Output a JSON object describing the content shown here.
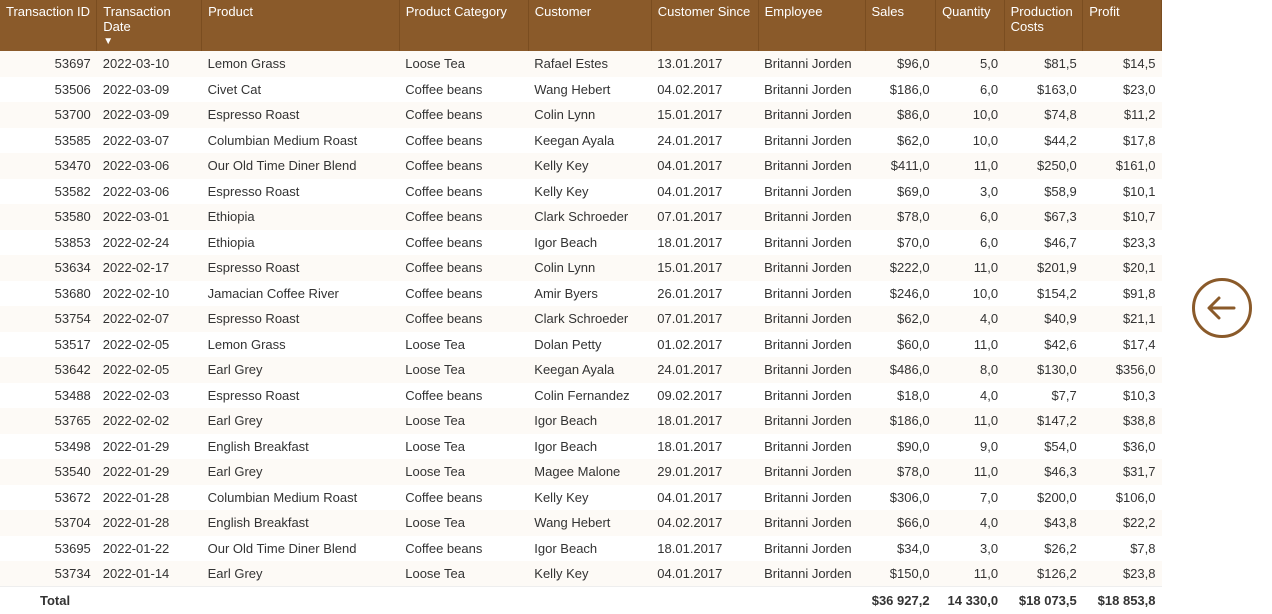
{
  "columns": [
    {
      "label": "Transaction ID",
      "key": "tid",
      "num": true
    },
    {
      "label": "Transaction Date",
      "key": "date",
      "num": false,
      "sort": "desc"
    },
    {
      "label": "Product",
      "key": "product",
      "num": false
    },
    {
      "label": "Product Category",
      "key": "category",
      "num": false
    },
    {
      "label": "Customer",
      "key": "customer",
      "num": false
    },
    {
      "label": "Customer Since",
      "key": "since",
      "num": false
    },
    {
      "label": "Employee",
      "key": "employee",
      "num": false
    },
    {
      "label": "Sales",
      "key": "sales",
      "num": true
    },
    {
      "label": "Quantity",
      "key": "qty",
      "num": true
    },
    {
      "label": "Production Costs",
      "key": "pc",
      "num": true
    },
    {
      "label": "Profit",
      "key": "profit",
      "num": true
    }
  ],
  "rows": [
    {
      "tid": "53697",
      "date": "2022-03-10",
      "product": "Lemon Grass",
      "category": "Loose Tea",
      "customer": "Rafael Estes",
      "since": "13.01.2017",
      "employee": "Britanni Jorden",
      "sales": "$96,0",
      "qty": "5,0",
      "pc": "$81,5",
      "profit": "$14,5"
    },
    {
      "tid": "53506",
      "date": "2022-03-09",
      "product": "Civet Cat",
      "category": "Coffee beans",
      "customer": "Wang Hebert",
      "since": "04.02.2017",
      "employee": "Britanni Jorden",
      "sales": "$186,0",
      "qty": "6,0",
      "pc": "$163,0",
      "profit": "$23,0"
    },
    {
      "tid": "53700",
      "date": "2022-03-09",
      "product": "Espresso Roast",
      "category": "Coffee beans",
      "customer": "Colin Lynn",
      "since": "15.01.2017",
      "employee": "Britanni Jorden",
      "sales": "$86,0",
      "qty": "10,0",
      "pc": "$74,8",
      "profit": "$11,2"
    },
    {
      "tid": "53585",
      "date": "2022-03-07",
      "product": "Columbian Medium Roast",
      "category": "Coffee beans",
      "customer": "Keegan Ayala",
      "since": "24.01.2017",
      "employee": "Britanni Jorden",
      "sales": "$62,0",
      "qty": "10,0",
      "pc": "$44,2",
      "profit": "$17,8"
    },
    {
      "tid": "53470",
      "date": "2022-03-06",
      "product": "Our Old Time Diner Blend",
      "category": "Coffee beans",
      "customer": "Kelly Key",
      "since": "04.01.2017",
      "employee": "Britanni Jorden",
      "sales": "$411,0",
      "qty": "11,0",
      "pc": "$250,0",
      "profit": "$161,0"
    },
    {
      "tid": "53582",
      "date": "2022-03-06",
      "product": "Espresso Roast",
      "category": "Coffee beans",
      "customer": "Kelly Key",
      "since": "04.01.2017",
      "employee": "Britanni Jorden",
      "sales": "$69,0",
      "qty": "3,0",
      "pc": "$58,9",
      "profit": "$10,1"
    },
    {
      "tid": "53580",
      "date": "2022-03-01",
      "product": "Ethiopia",
      "category": "Coffee beans",
      "customer": "Clark Schroeder",
      "since": "07.01.2017",
      "employee": "Britanni Jorden",
      "sales": "$78,0",
      "qty": "6,0",
      "pc": "$67,3",
      "profit": "$10,7"
    },
    {
      "tid": "53853",
      "date": "2022-02-24",
      "product": "Ethiopia",
      "category": "Coffee beans",
      "customer": "Igor Beach",
      "since": "18.01.2017",
      "employee": "Britanni Jorden",
      "sales": "$70,0",
      "qty": "6,0",
      "pc": "$46,7",
      "profit": "$23,3"
    },
    {
      "tid": "53634",
      "date": "2022-02-17",
      "product": "Espresso Roast",
      "category": "Coffee beans",
      "customer": "Colin Lynn",
      "since": "15.01.2017",
      "employee": "Britanni Jorden",
      "sales": "$222,0",
      "qty": "11,0",
      "pc": "$201,9",
      "profit": "$20,1"
    },
    {
      "tid": "53680",
      "date": "2022-02-10",
      "product": "Jamacian Coffee River",
      "category": "Coffee beans",
      "customer": "Amir Byers",
      "since": "26.01.2017",
      "employee": "Britanni Jorden",
      "sales": "$246,0",
      "qty": "10,0",
      "pc": "$154,2",
      "profit": "$91,8"
    },
    {
      "tid": "53754",
      "date": "2022-02-07",
      "product": "Espresso Roast",
      "category": "Coffee beans",
      "customer": "Clark Schroeder",
      "since": "07.01.2017",
      "employee": "Britanni Jorden",
      "sales": "$62,0",
      "qty": "4,0",
      "pc": "$40,9",
      "profit": "$21,1"
    },
    {
      "tid": "53517",
      "date": "2022-02-05",
      "product": "Lemon Grass",
      "category": "Loose Tea",
      "customer": "Dolan Petty",
      "since": "01.02.2017",
      "employee": "Britanni Jorden",
      "sales": "$60,0",
      "qty": "11,0",
      "pc": "$42,6",
      "profit": "$17,4"
    },
    {
      "tid": "53642",
      "date": "2022-02-05",
      "product": "Earl Grey",
      "category": "Loose Tea",
      "customer": "Keegan Ayala",
      "since": "24.01.2017",
      "employee": "Britanni Jorden",
      "sales": "$486,0",
      "qty": "8,0",
      "pc": "$130,0",
      "profit": "$356,0"
    },
    {
      "tid": "53488",
      "date": "2022-02-03",
      "product": "Espresso Roast",
      "category": "Coffee beans",
      "customer": "Colin Fernandez",
      "since": "09.02.2017",
      "employee": "Britanni Jorden",
      "sales": "$18,0",
      "qty": "4,0",
      "pc": "$7,7",
      "profit": "$10,3"
    },
    {
      "tid": "53765",
      "date": "2022-02-02",
      "product": "Earl Grey",
      "category": "Loose Tea",
      "customer": "Igor Beach",
      "since": "18.01.2017",
      "employee": "Britanni Jorden",
      "sales": "$186,0",
      "qty": "11,0",
      "pc": "$147,2",
      "profit": "$38,8"
    },
    {
      "tid": "53498",
      "date": "2022-01-29",
      "product": "English Breakfast",
      "category": "Loose Tea",
      "customer": "Igor Beach",
      "since": "18.01.2017",
      "employee": "Britanni Jorden",
      "sales": "$90,0",
      "qty": "9,0",
      "pc": "$54,0",
      "profit": "$36,0"
    },
    {
      "tid": "53540",
      "date": "2022-01-29",
      "product": "Earl Grey",
      "category": "Loose Tea",
      "customer": "Magee Malone",
      "since": "29.01.2017",
      "employee": "Britanni Jorden",
      "sales": "$78,0",
      "qty": "11,0",
      "pc": "$46,3",
      "profit": "$31,7"
    },
    {
      "tid": "53672",
      "date": "2022-01-28",
      "product": "Columbian Medium Roast",
      "category": "Coffee beans",
      "customer": "Kelly Key",
      "since": "04.01.2017",
      "employee": "Britanni Jorden",
      "sales": "$306,0",
      "qty": "7,0",
      "pc": "$200,0",
      "profit": "$106,0"
    },
    {
      "tid": "53704",
      "date": "2022-01-28",
      "product": "English Breakfast",
      "category": "Loose Tea",
      "customer": "Wang Hebert",
      "since": "04.02.2017",
      "employee": "Britanni Jorden",
      "sales": "$66,0",
      "qty": "4,0",
      "pc": "$43,8",
      "profit": "$22,2"
    },
    {
      "tid": "53695",
      "date": "2022-01-22",
      "product": "Our Old Time Diner Blend",
      "category": "Coffee beans",
      "customer": "Igor Beach",
      "since": "18.01.2017",
      "employee": "Britanni Jorden",
      "sales": "$34,0",
      "qty": "3,0",
      "pc": "$26,2",
      "profit": "$7,8"
    },
    {
      "tid": "53734",
      "date": "2022-01-14",
      "product": "Earl Grey",
      "category": "Loose Tea",
      "customer": "Kelly Key",
      "since": "04.01.2017",
      "employee": "Britanni Jorden",
      "sales": "$150,0",
      "qty": "11,0",
      "pc": "$126,2",
      "profit": "$23,8"
    }
  ],
  "totals": {
    "label": "Total",
    "sales": "$36 927,2",
    "qty": "14 330,0",
    "pc": "$18 073,5",
    "profit": "$18 853,8"
  },
  "back_label": "Back"
}
